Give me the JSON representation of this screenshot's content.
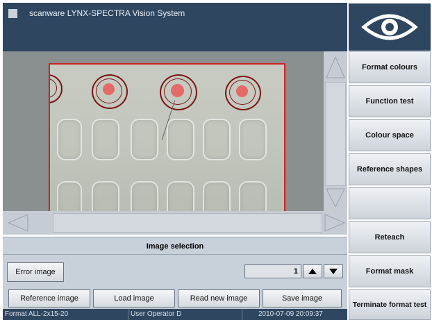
{
  "titlebar": {
    "title": "scanware LYNX-SPECTRA Vision System"
  },
  "viewer": {
    "scroll_arrow_up": "",
    "scroll_arrow_down": ""
  },
  "image_selection": {
    "header": "Image selection",
    "error_image_label": "Error image",
    "counter_value": "1",
    "reference_image_label": "Reference image",
    "load_image_label": "Load image",
    "read_new_image_label": "Read new image",
    "save_image_label": "Save image"
  },
  "sidebar": {
    "items": [
      {
        "label": "Format colours"
      },
      {
        "label": "Function test"
      },
      {
        "label": "Colour space"
      },
      {
        "label": "Reference shapes"
      },
      {
        "label": ""
      },
      {
        "label": "Reteach"
      },
      {
        "label": "Format mask"
      },
      {
        "label": "Terminate format test"
      }
    ]
  },
  "status": {
    "format": "Format ALL-2x15-20",
    "user": "User Operator D",
    "datetime": "2010-07-09 20:09:37"
  },
  "colors": {
    "title_bg": "#2e4660",
    "defect_ring": "#7a1414",
    "roi_border": "#d02020"
  }
}
